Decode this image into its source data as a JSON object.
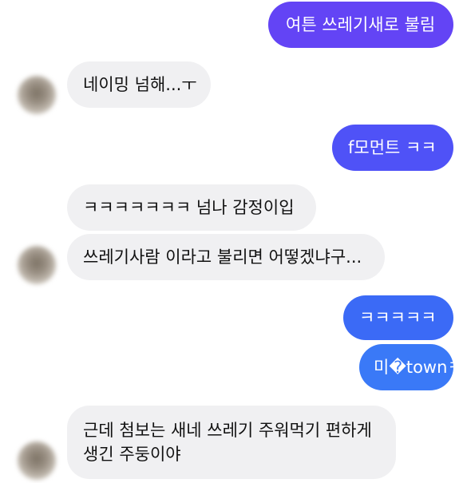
{
  "messages": [
    {
      "text": "여튼 쓰레기새로 불림",
      "direction": "outgoing",
      "color": "#6344f5"
    },
    {
      "text": "네이밍 넘해...ㅜ",
      "direction": "incoming"
    },
    {
      "text": "f모먼트 ㅋㅋ",
      "direction": "outgoing",
      "color": "#4f52f7"
    },
    {
      "text": "ㅋㅋㅋㅋㅋㅋㅋ 넘나 감정이입",
      "direction": "incoming"
    },
    {
      "text": "쓰레기사람 이라고 불리면 어떻겠냐구...",
      "direction": "incoming"
    },
    {
      "text": "ㅋㅋㅋㅋㅋ",
      "direction": "outgoing",
      "color": "#3b6af6"
    },
    {
      "text": "미�townㅋㅋ",
      "direction": "outgoing",
      "color": "#3a79f7"
    },
    {
      "text_line1": "근데 첨보는 새네 쓰레기 주워먹기 편하게",
      "text_line2": "생긴 주둥이야",
      "direction": "incoming"
    }
  ],
  "colors": {
    "incoming_bg": "#f0f0f2",
    "incoming_text": "#111111",
    "outgoing_text": "#ffffff"
  }
}
